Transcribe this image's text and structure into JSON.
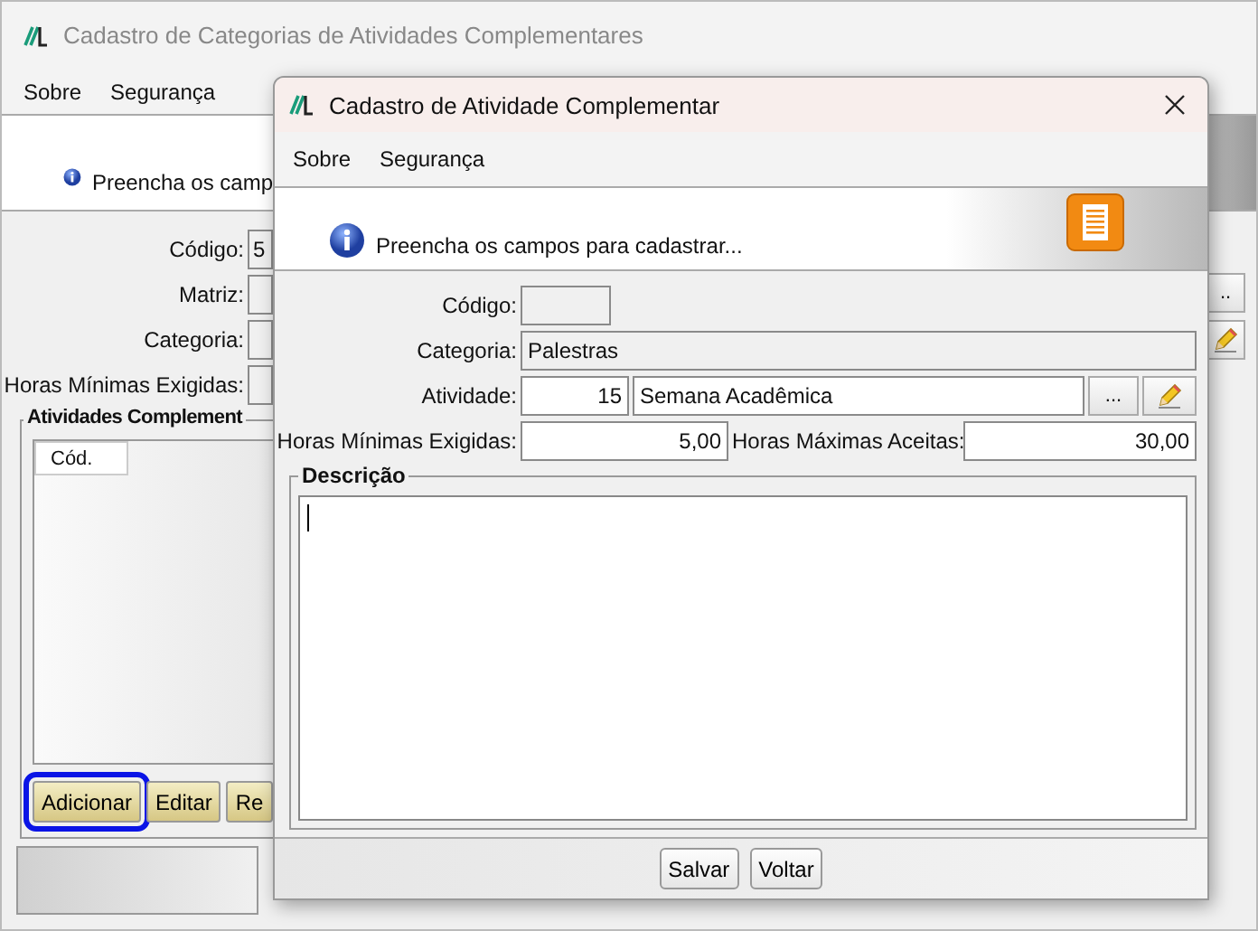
{
  "main_window": {
    "title": "Cadastro de Categorias de Atividades Complementares",
    "menu": [
      "Sobre",
      "Segurança"
    ],
    "info": "Preencha os camp",
    "fields": [
      {
        "label": "Código:",
        "value": "5"
      },
      {
        "label": "Matriz:"
      },
      {
        "label": "Categoria:"
      },
      {
        "label": "Horas Mínimas Exigidas:"
      }
    ],
    "group": {
      "title": "Atividades Complement",
      "columns": [
        "Cód."
      ]
    },
    "buttons": [
      {
        "label": "Adicionar",
        "focused": true
      },
      {
        "label": "Editar",
        "focused": false
      },
      {
        "label": "Re",
        "focused": false
      }
    ],
    "side_buttons": [
      {
        "kind": "browse",
        "label": ".."
      },
      {
        "kind": "edit"
      }
    ]
  },
  "dialog": {
    "title": "Cadastro de Atividade Complementar",
    "menu": [
      "Sobre",
      "Segurança"
    ],
    "info": "Preencha os campos para cadastrar...",
    "codigo": {
      "label": "Código:"
    },
    "categoria": {
      "label": "Categoria:",
      "value": "Palestras"
    },
    "atividade": {
      "label": "Atividade:",
      "code": "15",
      "name": "Semana Acadêmica",
      "browse": "..."
    },
    "horas": [
      {
        "label": "Horas Mínimas Exigidas:",
        "value": "5,00"
      },
      {
        "label": "Horas Máximas Aceitas:",
        "value": "30,00"
      }
    ],
    "descricao": {
      "title": "Descrição"
    },
    "buttons": [
      "Salvar",
      "Voltar"
    ]
  }
}
